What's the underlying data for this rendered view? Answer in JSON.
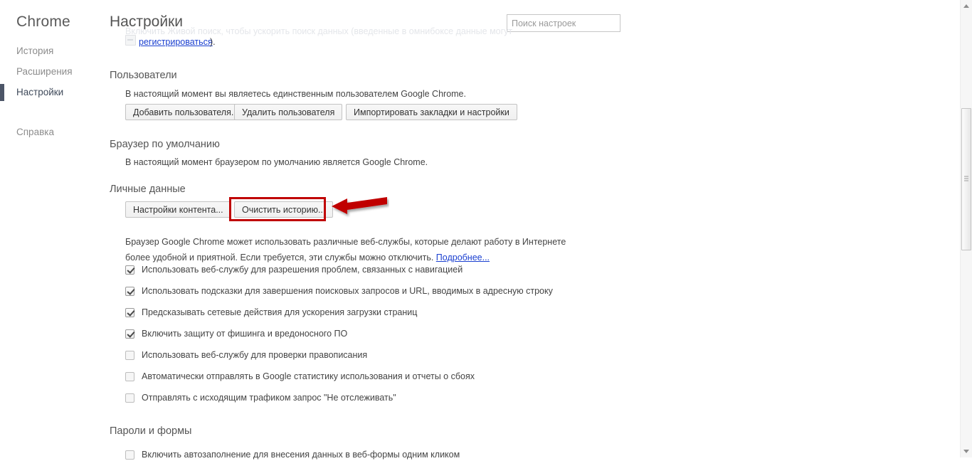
{
  "window": {
    "title": "Настройки"
  },
  "sidebar": {
    "brand": "Chrome",
    "items": [
      {
        "id": "history",
        "label": "История",
        "selected": false
      },
      {
        "id": "extensions",
        "label": "Расширения",
        "selected": false
      },
      {
        "id": "settings",
        "label": "Настройки",
        "selected": true
      },
      {
        "id": "help",
        "label": "Справка",
        "selected": false
      }
    ],
    "selected_marker_color": "#4c5567"
  },
  "header": {
    "page_title": "Настройки",
    "search": {
      "placeholder": "Поиск настроек",
      "value": ""
    }
  },
  "clipped_row": {
    "faded_text": "Включить Живой поиск, чтобы ускорить поиск данных (введенные в омнибоксе данные могут",
    "link": "регистрироваться",
    "trailing": ")."
  },
  "sections": {
    "users": {
      "title": "Пользователи",
      "description": "В настоящий момент вы являетесь единственным пользователем Google Chrome.",
      "buttons": [
        {
          "id": "add-user",
          "label": "Добавить пользователя..."
        },
        {
          "id": "delete-user",
          "label": "Удалить пользователя"
        },
        {
          "id": "import",
          "label": "Импортировать закладки и настройки"
        }
      ]
    },
    "default_browser": {
      "title": "Браузер по умолчанию",
      "description": "В настоящий момент браузером по умолчанию является Google Chrome."
    },
    "personal_data": {
      "title": "Личные данные",
      "buttons": [
        {
          "id": "content-settings",
          "label": "Настройки контента..."
        },
        {
          "id": "clear-history",
          "label": "Очистить историю...",
          "highlighted": true
        }
      ],
      "paragraph_part1": "Браузер Google Chrome может использовать различные веб-службы, которые делают работу в Интернете более удобной и приятной. Если требуется, эти службы можно отключить. ",
      "paragraph_link": "Подробнее...",
      "checkboxes": [
        {
          "id": "navigation-errors",
          "label": "Использовать веб-службу для разрешения проблем, связанных с навигацией",
          "checked": true
        },
        {
          "id": "search-suggest",
          "label": "Использовать подсказки для завершения поисковых запросов и URL, вводимых в адресную строку",
          "checked": true
        },
        {
          "id": "network-predict",
          "label": "Предсказывать сетевые действия для ускорения загрузки страниц",
          "checked": true
        },
        {
          "id": "safe-browsing",
          "label": "Включить защиту от фишинга и вредоносного ПО",
          "checked": true
        },
        {
          "id": "spelling-service",
          "label": "Использовать веб-службу для проверки правописания",
          "checked": false
        },
        {
          "id": "usage-stats",
          "label": "Автоматически отправлять в Google статистику использования и отчеты о сбоях",
          "checked": false
        },
        {
          "id": "do-not-track",
          "label": "Отправлять с исходящим трафиком запрос \"Не отслеживать\"",
          "checked": false
        }
      ]
    },
    "passwords_and_forms": {
      "title": "Пароли и формы",
      "checkboxes": [
        {
          "id": "autofill",
          "label": "Включить автозаполнение для внесения данных в веб-формы одним кликом",
          "checked": false
        }
      ]
    }
  },
  "annotations": {
    "highlight_color": "#c00000",
    "arrow_color": "#c00000",
    "target_label": "Очистить историю..."
  },
  "scrollbar": {
    "orientation": "vertical",
    "up_arrow": "scroll-up",
    "down_arrow": "scroll-down"
  }
}
